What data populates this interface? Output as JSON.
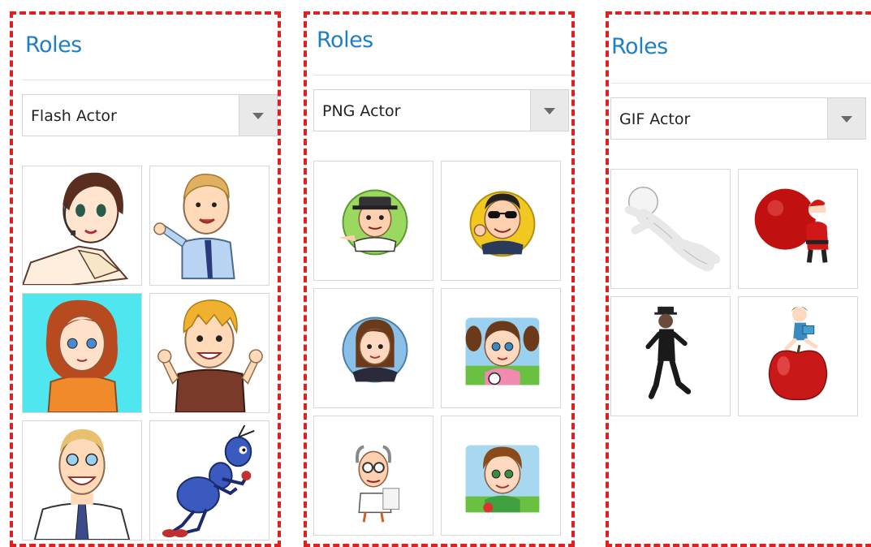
{
  "panels": [
    {
      "title": "Roles",
      "selected_actor": "Flash Actor",
      "actors": [
        {
          "icon": "businesswoman-with-headset-icon"
        },
        {
          "icon": "man-presenting-icon"
        },
        {
          "icon": "red-haired-woman-icon"
        },
        {
          "icon": "cheering-boy-icon"
        },
        {
          "icon": "smiling-businessman-icon"
        },
        {
          "icon": "walking-blue-ant-icon"
        }
      ]
    },
    {
      "title": "Roles",
      "selected_actor": "PNG Actor",
      "actors": [
        {
          "icon": "man-with-hat-avatar-icon"
        },
        {
          "icon": "man-with-sunglasses-avatar-icon"
        },
        {
          "icon": "businesswoman-avatar-icon"
        },
        {
          "icon": "girl-with-pigtails-avatar-icon"
        },
        {
          "icon": "old-scientist-avatar-icon"
        },
        {
          "icon": "boy-outdoors-avatar-icon"
        }
      ]
    },
    {
      "title": "Roles",
      "selected_actor": "GIF Actor",
      "actors": [
        {
          "icon": "white-3d-figure-lying-icon"
        },
        {
          "icon": "santa-with-sack-icon"
        },
        {
          "icon": "dancing-man-in-black-icon"
        },
        {
          "icon": "girl-reading-on-apple-icon"
        }
      ]
    }
  ],
  "colors": {
    "title": "#1e7fc6",
    "panel_border": "#e02020"
  }
}
